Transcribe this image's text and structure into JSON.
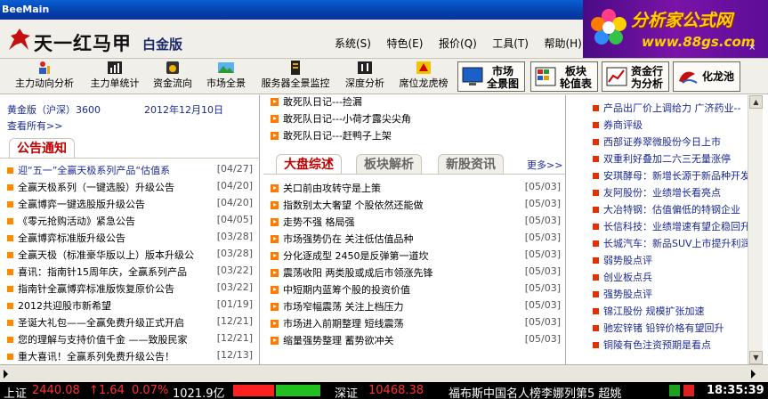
{
  "window": {
    "title": "BeeMain"
  },
  "brand": {
    "name": "天一红马甲",
    "edition": "白金版"
  },
  "menus": [
    "系统(S)",
    "特色(E)",
    "报价(Q)",
    "工具(T)",
    "帮助(H)"
  ],
  "ad": {
    "line1": "分析家公式网",
    "line2": "www.88gs.com",
    "mark": "×"
  },
  "toolbar": {
    "small": [
      "主力动向分析",
      "主力单统计",
      "资金流向",
      "市场全景",
      "服务器全景监控",
      "深度分析",
      "席位龙虎榜"
    ],
    "big": [
      {
        "label1": "市场",
        "label2": "全景图"
      },
      {
        "label1": "板块",
        "label2": "轮值表"
      },
      {
        "label1": "资金行",
        "label2": "为分析"
      },
      {
        "label1": "化龙池",
        "label2": ""
      }
    ]
  },
  "left": {
    "info": "黄金版（沪深）3600",
    "date": "2012年12月10日",
    "all_link": "查看所有>>",
    "section_title": "公告通知",
    "notices": [
      {
        "text": "迎“五一”全赢天极系列产品“估值系",
        "date": "[04/27]",
        "highlight": true
      },
      {
        "text": "全赢天极系列（一键选股）升级公告",
        "date": "[04/20]"
      },
      {
        "text": "全赢博弈一键选股版升级公告",
        "date": "[04/20]"
      },
      {
        "text": "《零元抢购活动》紧急公告",
        "date": "[04/05]"
      },
      {
        "text": "全赢博弈标准版升级公告",
        "date": "[03/28]"
      },
      {
        "text": "全赢天极（标准豪华版以上）版本升级公",
        "date": "[03/28]"
      },
      {
        "text": "喜讯：指南针15周年庆，全赢系列产品",
        "date": "[03/22]"
      },
      {
        "text": "指南针全赢博弈标准版恢复原价公告",
        "date": "[03/22]"
      },
      {
        "text": "2012共迎股市新希望",
        "date": "[01/19]"
      },
      {
        "text": "圣诞大礼包——全赢免费升级正式开启",
        "date": "[12/21]"
      },
      {
        "text": "您的理解与支持价值千金 ——致股民家",
        "date": "[12/21]"
      },
      {
        "text": "重大喜讯！全赢系列免费升级公告！",
        "date": "[12/13]"
      }
    ]
  },
  "mid": {
    "top_items": [
      "敢死队日记---捡漏",
      "敢死队日记---小荷才露尖尖角",
      "敢死队日记---赶鸭子上架"
    ],
    "tabs": [
      "大盘综述",
      "板块解析",
      "新股资讯"
    ],
    "more": "更多>>",
    "news": [
      {
        "text": "关口前由攻转守是上策",
        "date": "[05/03]"
      },
      {
        "text": "指数别太大奢望 个股依然还能做",
        "date": "[05/03]"
      },
      {
        "text": "走势不强 格局强",
        "date": "[05/03]"
      },
      {
        "text": "市场强势仍在 关注低估值品种",
        "date": "[05/03]"
      },
      {
        "text": "分化逐成型 2450是反弹第一道坎",
        "date": "[05/03]"
      },
      {
        "text": "震荡收阳 两类股或成后市领涨先锋",
        "date": "[05/03]"
      },
      {
        "text": "中短期内蓝筹个股的投资价值",
        "date": "[05/03]"
      },
      {
        "text": "市场窄幅震荡 关注上档压力",
        "date": "[05/03]"
      },
      {
        "text": "市场进入前期整理 短线震荡",
        "date": "[05/03]"
      },
      {
        "text": "缩量强势整理 蓄势欲冲关",
        "date": "[05/03]"
      }
    ]
  },
  "right": {
    "items": [
      "产品出厂价上调给力 广济药业--",
      "券商评级",
      "西部证券翠微股份今日上市",
      "双重利好叠加二六三无量涨停",
      "安琪酵母：新增长源于新品种开发",
      "友阿股份：业绩增长看亮点",
      "大冶特钢：估值偏低的特钢企业",
      "长信科技：业绩增速有望企稳回升",
      "长城汽车：新品SUV上市提升利润",
      "弱势股点评",
      "创业板点兵",
      "强势股点评",
      "锦江股份 规模扩张加速",
      "驰宏锌锗 铅锌价格有望回升",
      "铜陵有色注资预期是看点"
    ]
  },
  "ticker": {
    "sh_label": "上证",
    "sh_value": "2440.08",
    "sh_change": "↑1.64",
    "sh_pct": "0.07%",
    "sh_vol": "1021.9亿",
    "sz_label": "深证",
    "sz_value": "10468.38",
    "scroll_text": "福布斯中国名人榜李娜列第5 超姚",
    "time": "18:35:39"
  },
  "colors": {
    "accent_red": "#c00000",
    "link_blue": "#1b2a93",
    "bullet_orange": "#ff8a00"
  }
}
